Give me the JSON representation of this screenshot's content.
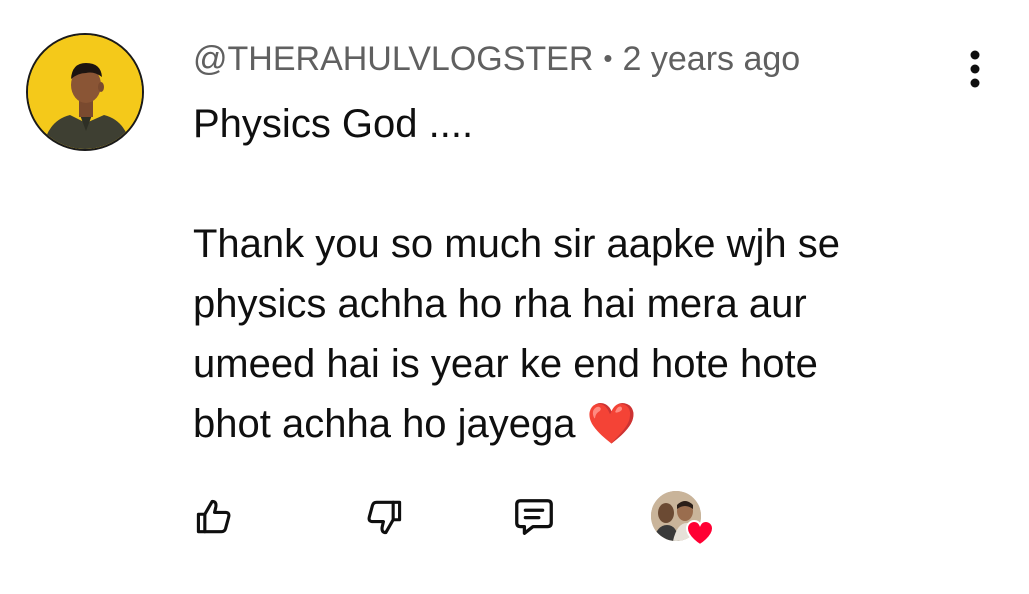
{
  "comment": {
    "author": "@THERAHULVLOGSTER",
    "separator": "•",
    "timestamp": "2 years ago",
    "text": "Physics God ....\n\nThank you so much sir aapke wjh se\nphysics achha ho rha hai mera aur\numeed hai is year ke end hote hote\nbhot achha ho jayega ❤️"
  },
  "icons": {
    "avatar": "user-avatar",
    "more": "more-vertical-icon",
    "like": "thumbs-up-icon",
    "dislike": "thumbs-down-icon",
    "reply": "reply-comment-icon",
    "creator_heart": "creator-heart-badge"
  },
  "colors": {
    "background": "#ffffff",
    "text_primary": "#0f0f0f",
    "text_secondary": "#606060",
    "avatar_bg": "#f4c91a",
    "heart": "#ff0033"
  }
}
